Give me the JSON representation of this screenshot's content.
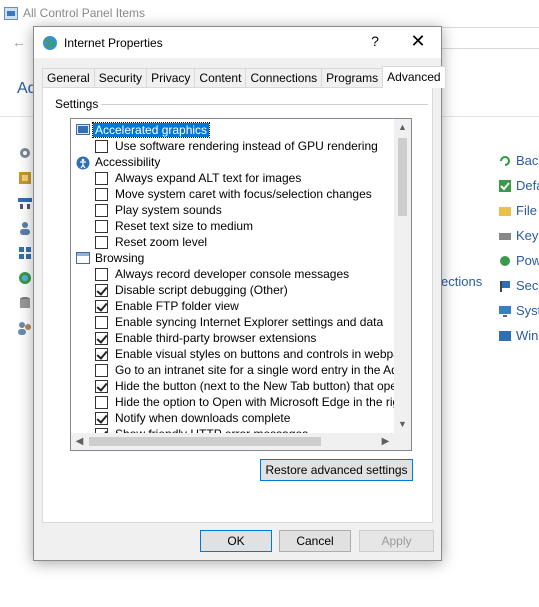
{
  "background": {
    "window_title": "All Control Panel Items",
    "adjust_text": "Ad",
    "sections_text": "ections",
    "right_items": [
      "Back",
      "Defa",
      "File",
      "Keyb",
      "Pow",
      "Secu",
      "Syst",
      "Win"
    ]
  },
  "dialog": {
    "title": "Internet Properties",
    "help_glyph": "?",
    "close_glyph": "✕",
    "tabs": [
      "General",
      "Security",
      "Privacy",
      "Content",
      "Connections",
      "Programs",
      "Advanced"
    ],
    "active_tab": "Advanced",
    "group_label": "Settings",
    "rows": [
      {
        "type": "group",
        "icon": "monitor",
        "text": "Accelerated graphics",
        "selected": true
      },
      {
        "type": "checkbox",
        "checked": false,
        "text": "Use software rendering instead of GPU rendering"
      },
      {
        "type": "group",
        "icon": "accessibility",
        "text": "Accessibility"
      },
      {
        "type": "checkbox",
        "checked": false,
        "text": "Always expand ALT text for images"
      },
      {
        "type": "checkbox",
        "checked": false,
        "text": "Move system caret with focus/selection changes"
      },
      {
        "type": "checkbox",
        "checked": false,
        "text": "Play system sounds"
      },
      {
        "type": "checkbox",
        "checked": false,
        "text": "Reset text size to medium"
      },
      {
        "type": "checkbox",
        "checked": false,
        "text": "Reset zoom level"
      },
      {
        "type": "group",
        "icon": "browsing",
        "text": "Browsing"
      },
      {
        "type": "checkbox",
        "checked": false,
        "text": "Always record developer console messages"
      },
      {
        "type": "checkbox",
        "checked": true,
        "text": "Disable script debugging (Other)"
      },
      {
        "type": "checkbox",
        "checked": true,
        "text": "Enable FTP folder view"
      },
      {
        "type": "checkbox",
        "checked": false,
        "text": "Enable syncing Internet Explorer settings and data"
      },
      {
        "type": "checkbox",
        "checked": true,
        "text": "Enable third-party browser extensions"
      },
      {
        "type": "checkbox",
        "checked": true,
        "text": "Enable visual styles on buttons and controls in webpages"
      },
      {
        "type": "checkbox",
        "checked": false,
        "text": "Go to an intranet site for a single word entry in the Addres"
      },
      {
        "type": "checkbox",
        "checked": true,
        "text": "Hide the button (next to the New Tab button) that opens"
      },
      {
        "type": "checkbox",
        "checked": false,
        "text": "Hide the option to Open with Microsoft Edge in the right-cl"
      },
      {
        "type": "checkbox",
        "checked": true,
        "text": "Notify when downloads complete"
      },
      {
        "type": "checkbox",
        "checked": true,
        "text": "Show friendly HTTP error messages"
      }
    ],
    "buttons": {
      "restore": "Restore advanced settings",
      "ok": "OK",
      "cancel": "Cancel",
      "apply": "Apply"
    }
  }
}
